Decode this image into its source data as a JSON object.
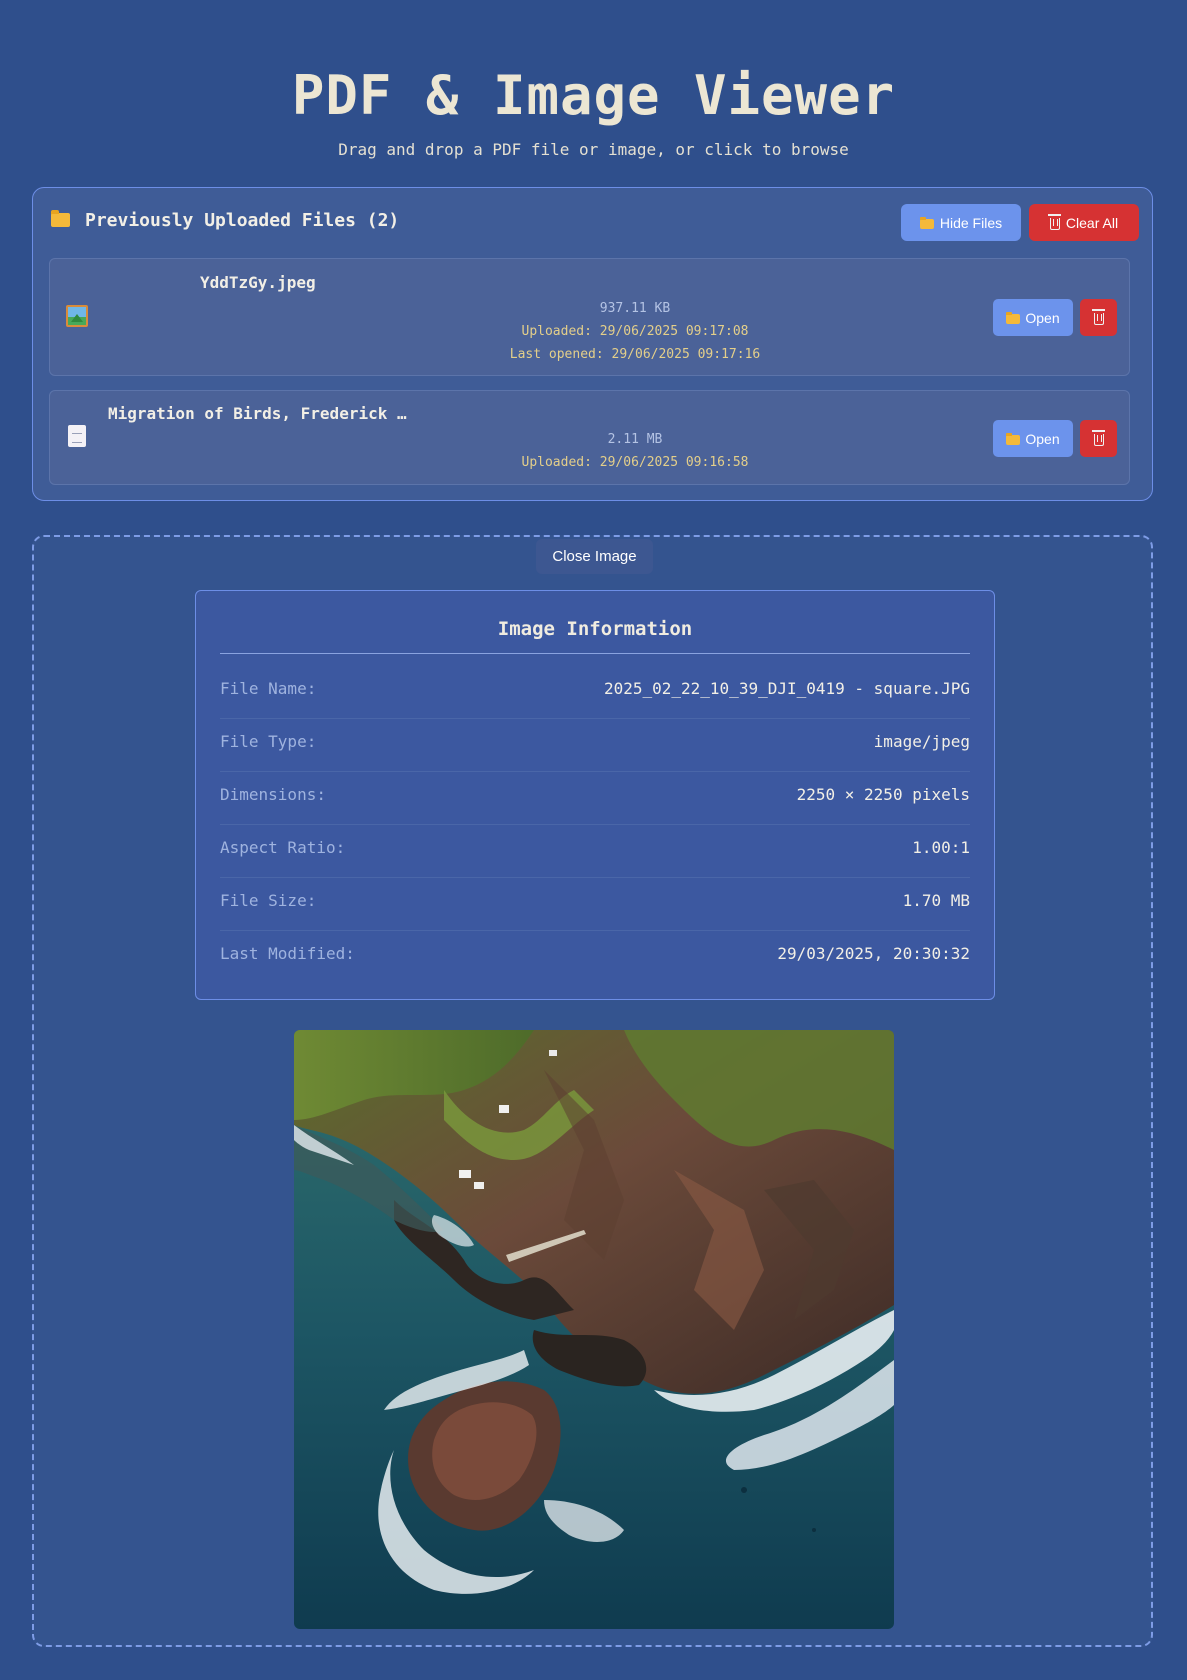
{
  "header": {
    "title": "PDF & Image Viewer",
    "subtitle": "Drag and drop a PDF file or image, or click to browse"
  },
  "uploaded": {
    "title": "Previously Uploaded Files (2)",
    "hide_label": "Hide Files",
    "clear_label": "Clear All",
    "files": [
      {
        "name": "YddTzGy.jpeg",
        "size": "937.11 KB",
        "uploaded": "Uploaded: 29/06/2025 09:17:08",
        "last_opened": "Last opened: 29/06/2025 09:17:16",
        "icon": "image-icon",
        "open_label": "Open"
      },
      {
        "name": "Migration of Birds, Frederick …",
        "size": "2.11 MB",
        "uploaded": "Uploaded: 29/06/2025 09:16:58",
        "icon": "document-icon",
        "open_label": "Open"
      }
    ]
  },
  "viewer": {
    "close_label": "Close Image",
    "info": {
      "title": "Image Information",
      "rows": [
        {
          "label": "File Name:",
          "value": "2025_02_22_10_39_DJI_0419 - square.JPG"
        },
        {
          "label": "File Type:",
          "value": "image/jpeg"
        },
        {
          "label": "Dimensions:",
          "value": "2250 × 2250 pixels"
        },
        {
          "label": "Aspect Ratio:",
          "value": "1.00:1"
        },
        {
          "label": "File Size:",
          "value": "1.70 MB"
        },
        {
          "label": "Last Modified:",
          "value": "29/03/2025, 20:30:32"
        }
      ]
    }
  },
  "colors": {
    "background": "#2f4f8c",
    "accent": "#6c93ec",
    "danger": "#d63233",
    "meta_date": "#e4cf8a"
  }
}
